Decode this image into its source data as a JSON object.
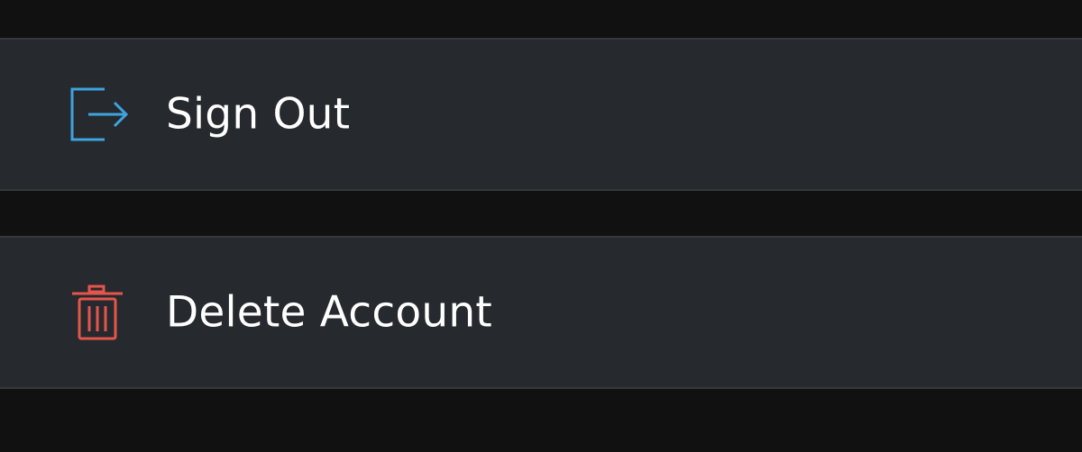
{
  "actions": {
    "sign_out": {
      "label": "Sign Out",
      "icon": "sign-out-icon",
      "icon_color": "#3fa3dd"
    },
    "delete_account": {
      "label": "Delete Account",
      "icon": "trash-icon",
      "icon_color": "#e5554c"
    }
  },
  "colors": {
    "background": "#111111",
    "row_background": "#26292e",
    "row_border": "#35383d",
    "text": "#ffffff"
  }
}
